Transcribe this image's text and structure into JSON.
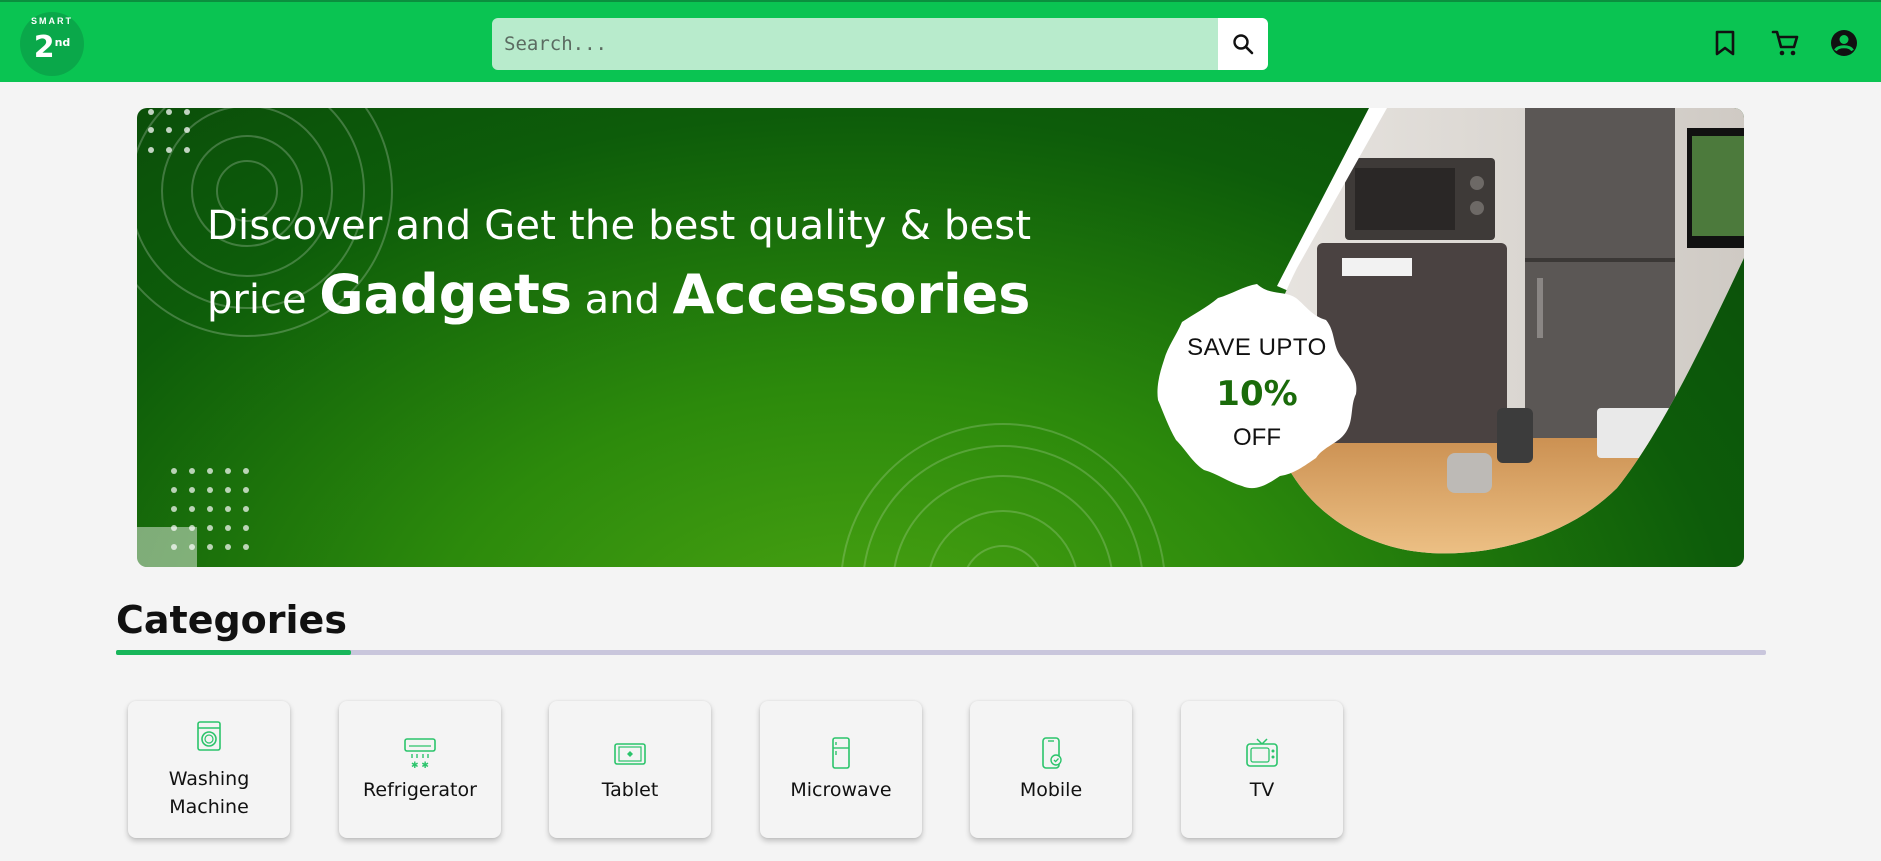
{
  "header": {
    "logo": {
      "ring_text": "SMART",
      "number": "2",
      "suffix": "nd"
    },
    "search": {
      "placeholder": "Search..."
    },
    "icons": [
      "bookmark-icon",
      "cart-icon",
      "account-icon"
    ],
    "colors": {
      "header_bg": "#0ac452",
      "search_bg": "#b8ebcc"
    }
  },
  "banner": {
    "line1": "Discover and Get the best quality & best",
    "line2_prefix": "price",
    "line2_bold1": "Gadgets",
    "line2_mid": "and",
    "line2_bold2": "Accessories",
    "badge": {
      "top": "SAVE UPTO",
      "amount": "10%",
      "bottom": "OFF"
    }
  },
  "categories": {
    "title": "Categories",
    "items": [
      {
        "label": "Washing Machine",
        "icon": "washing-machine-icon"
      },
      {
        "label": "Refrigerator",
        "icon": "air-conditioner-icon"
      },
      {
        "label": "Tablet",
        "icon": "tablet-icon"
      },
      {
        "label": "Microwave",
        "icon": "fridge-icon"
      },
      {
        "label": "Mobile",
        "icon": "mobile-icon"
      },
      {
        "label": "TV",
        "icon": "tv-icon"
      }
    ],
    "colors": {
      "icon": "#2bc46b",
      "underline_accent": "#18b65a",
      "underline_base": "#c9c6dc"
    }
  }
}
